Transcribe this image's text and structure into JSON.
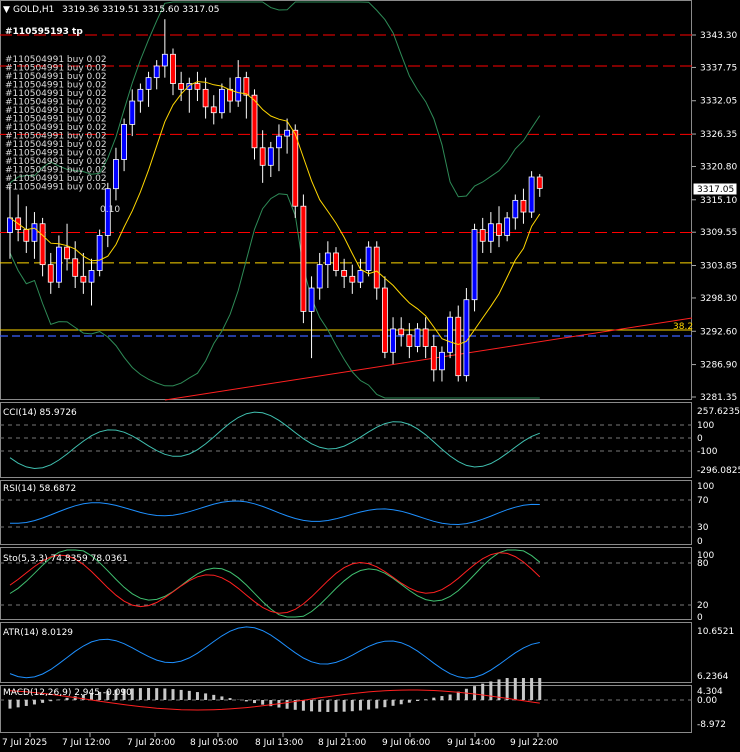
{
  "header": {
    "symbol": "GOLD,H1",
    "ohlc": "3319.36 3319.51 3315.60 3317.05"
  },
  "price_axis": {
    "ticks": [
      "3343.30",
      "3337.75",
      "3332.05",
      "3326.35",
      "3320.80",
      "3315.10",
      "3309.55",
      "3303.85",
      "3298.30",
      "3292.60",
      "3286.90",
      "3281.35"
    ],
    "current_price": "3317.05",
    "fib_label": "38.2"
  },
  "order_labels": {
    "top": "#110595193 tp",
    "buy_line": "#110504991 buy 0.02",
    "small": "0.10"
  },
  "indicators": {
    "cci": {
      "label": "CCI(14) 85.9726",
      "ticks": [
        "257.6235",
        "100",
        "0",
        "-100",
        "-296.0825"
      ]
    },
    "rsi": {
      "label": "RSI(14) 58.6872",
      "ticks": [
        "100",
        "70",
        "30",
        "0"
      ]
    },
    "sto": {
      "label": "Sto(5,3,3) 74.8359 78.0361",
      "ticks": [
        "100",
        "80",
        "20",
        "0"
      ]
    },
    "atr": {
      "label": "ATR(14) 8.0129",
      "ticks": [
        "10.6521",
        "6.2364"
      ]
    },
    "macd": {
      "label": "MACD(12,26,9) 2.945 -0.090",
      "ticks": [
        "4.304",
        "0.00",
        "-8.972"
      ]
    }
  },
  "time_axis": [
    "7 Jul 2025",
    "7 Jul 12:00",
    "7 Jul 20:00",
    "8 Jul 05:00",
    "8 Jul 13:00",
    "8 Jul 21:00",
    "9 Jul 06:00",
    "9 Jul 14:00",
    "9 Jul 22:00"
  ],
  "colors": {
    "bull": "#ffffff",
    "bear": "#ff0000",
    "bull_body": "#0000ff",
    "bands": "#2e8b57",
    "ma": "#ffd700",
    "red_dash": "#ff0000",
    "yellow_dash": "#ffd700",
    "ind_line": "#1e90ff"
  },
  "chart_data": {
    "type": "candlestick",
    "symbol": "GOLD",
    "timeframe": "H1",
    "ylim": [
      3280,
      3350
    ],
    "candles": [
      [
        3309.5,
        3318,
        3305,
        3312
      ],
      [
        3312,
        3316,
        3308,
        3310
      ],
      [
        3310,
        3314,
        3306,
        3308
      ],
      [
        3308,
        3313,
        3305,
        3311
      ],
      [
        3311,
        3312,
        3302,
        3304
      ],
      [
        3304,
        3306,
        3299,
        3301
      ],
      [
        3301,
        3309,
        3300,
        3307
      ],
      [
        3307,
        3311,
        3303,
        3305
      ],
      [
        3305,
        3308,
        3300,
        3302
      ],
      [
        3302,
        3306,
        3299,
        3301
      ],
      [
        3301,
        3305,
        3297,
        3303
      ],
      [
        3303,
        3310,
        3302,
        3309
      ],
      [
        3309,
        3318,
        3307,
        3317
      ],
      [
        3317,
        3324,
        3315,
        3322
      ],
      [
        3322,
        3329,
        3320,
        3328
      ],
      [
        3328,
        3334,
        3326,
        3332
      ],
      [
        3332,
        3335,
        3330,
        3334
      ],
      [
        3334,
        3337,
        3331,
        3336
      ],
      [
        3336,
        3339,
        3334,
        3338
      ],
      [
        3338,
        3346,
        3336,
        3340
      ],
      [
        3340,
        3341,
        3333,
        3335
      ],
      [
        3335,
        3337,
        3332,
        3334
      ],
      [
        3334,
        3336,
        3330,
        3335
      ],
      [
        3335,
        3337,
        3332,
        3334
      ],
      [
        3334,
        3336,
        3329,
        3331
      ],
      [
        3331,
        3333,
        3328,
        3330
      ],
      [
        3330,
        3335,
        3329,
        3334
      ],
      [
        3334,
        3336,
        3330,
        3332
      ],
      [
        3332,
        3339,
        3331,
        3336
      ],
      [
        3336,
        3337,
        3329,
        3333
      ],
      [
        3333,
        3334,
        3322,
        3324
      ],
      [
        3324,
        3327,
        3318,
        3321
      ],
      [
        3321,
        3325,
        3319,
        3324
      ],
      [
        3324,
        3328,
        3320,
        3326
      ],
      [
        3326,
        3329,
        3323,
        3327
      ],
      [
        3327,
        3328,
        3312,
        3314
      ],
      [
        3314,
        3316,
        3294,
        3296
      ],
      [
        3296,
        3302,
        3288,
        3300
      ],
      [
        3300,
        3306,
        3298,
        3304
      ],
      [
        3304,
        3308,
        3300,
        3306
      ],
      [
        3306,
        3307,
        3302,
        3303
      ],
      [
        3303,
        3305,
        3300,
        3302
      ],
      [
        3302,
        3304,
        3299,
        3301
      ],
      [
        3301,
        3305,
        3300,
        3303
      ],
      [
        3303,
        3308,
        3302,
        3307
      ],
      [
        3307,
        3308,
        3298,
        3300
      ],
      [
        3300,
        3302,
        3288,
        3289
      ],
      [
        3289,
        3295,
        3287,
        3293
      ],
      [
        3293,
        3295,
        3290,
        3292
      ],
      [
        3292,
        3294,
        3288,
        3290
      ],
      [
        3290,
        3294,
        3289,
        3293
      ],
      [
        3293,
        3295,
        3288,
        3290
      ],
      [
        3290,
        3292,
        3284,
        3286
      ],
      [
        3286,
        3290,
        3284,
        3289
      ],
      [
        3289,
        3296,
        3288,
        3295
      ],
      [
        3295,
        3297,
        3284,
        3285
      ],
      [
        3285,
        3300,
        3284,
        3298
      ],
      [
        3298,
        3311,
        3296,
        3310
      ],
      [
        3310,
        3312,
        3306,
        3308
      ],
      [
        3308,
        3313,
        3306,
        3311
      ],
      [
        3311,
        3314,
        3307,
        3309
      ],
      [
        3309,
        3313,
        3308,
        3312
      ],
      [
        3312,
        3316,
        3310,
        3315
      ],
      [
        3315,
        3317,
        3311,
        3313
      ],
      [
        3313,
        3320,
        3312,
        3319
      ],
      [
        3319,
        3319.5,
        3315.6,
        3317.05
      ]
    ]
  }
}
